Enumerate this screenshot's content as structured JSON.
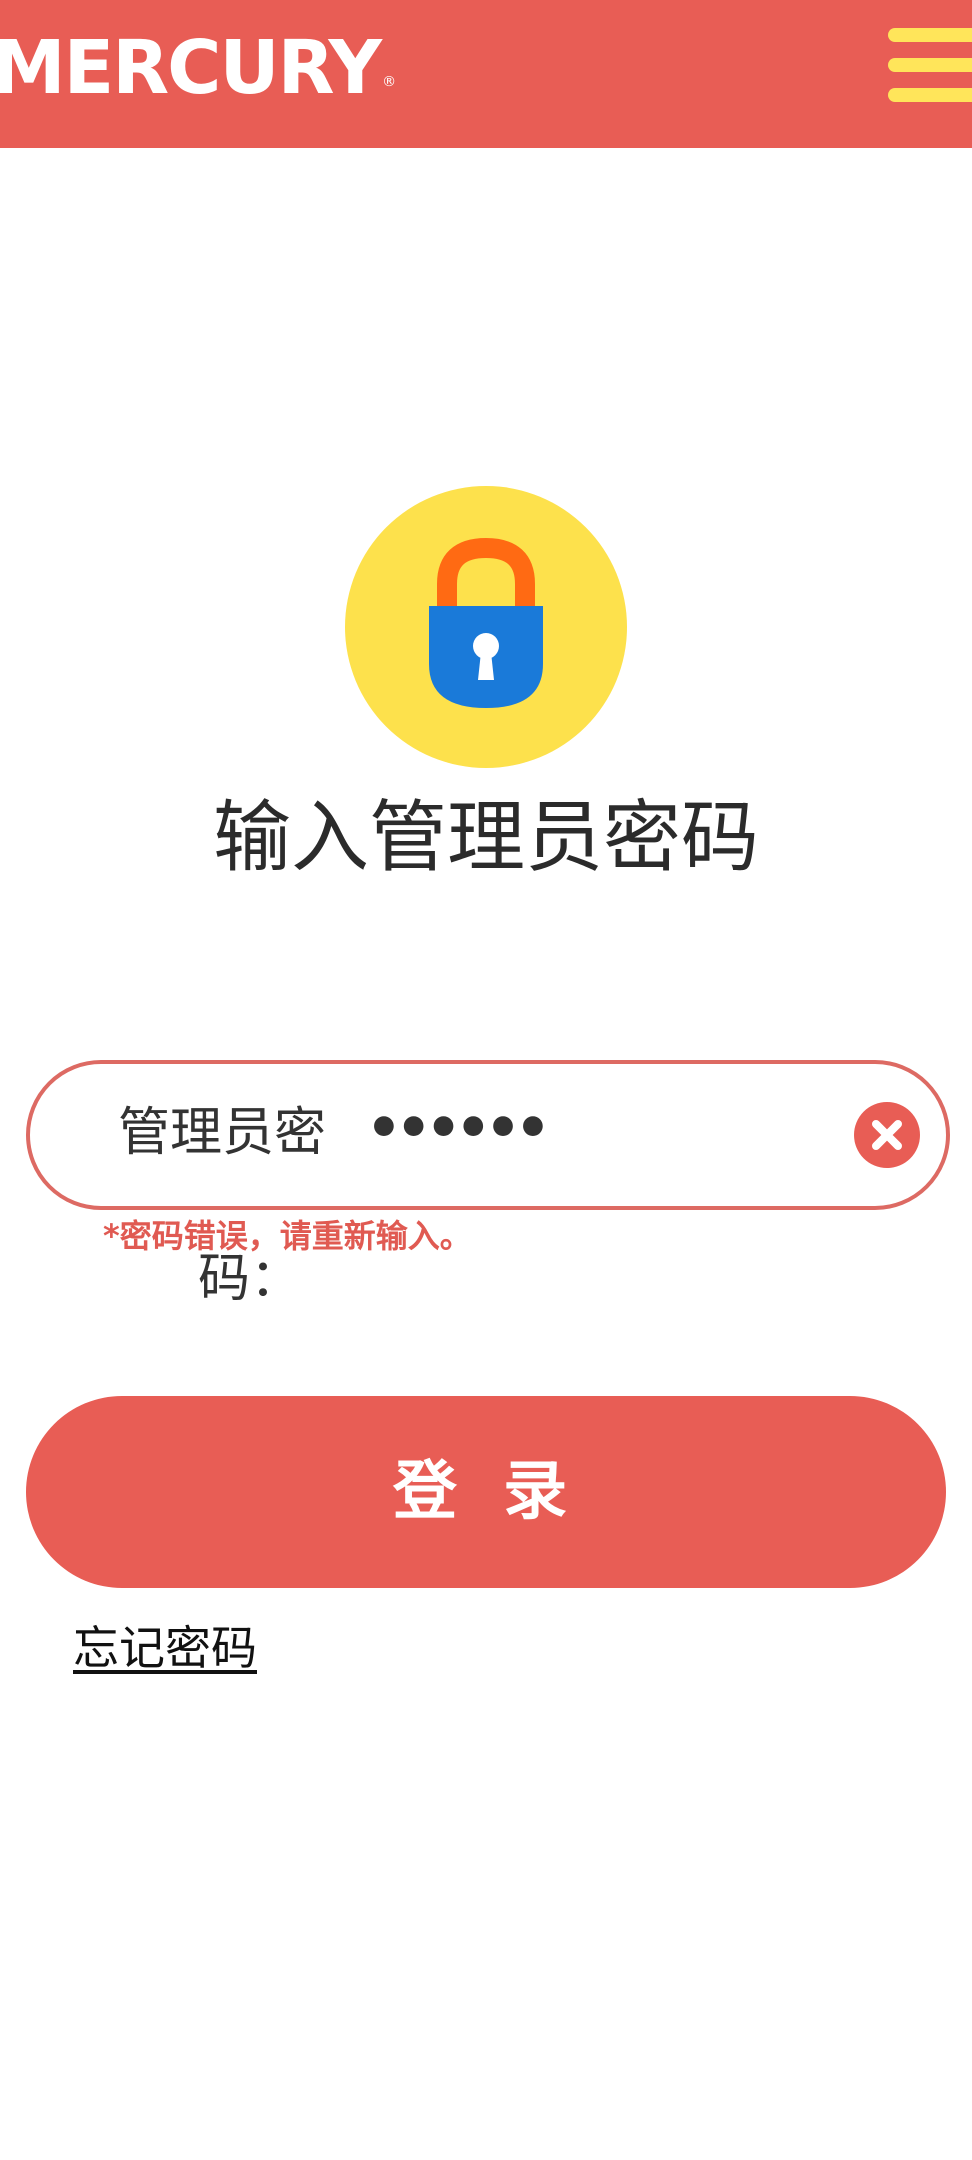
{
  "header": {
    "brand": "MERCURY",
    "registered_mark": "®",
    "menu_icon": "hamburger-menu-icon"
  },
  "colors": {
    "brand_red": "#e85d55",
    "menu_yellow": "#ffe55a",
    "lock_circle": "#fde14c",
    "lock_body": "#1a7ad9",
    "lock_shackle": "#ff6a13"
  },
  "login": {
    "lock_icon": "padlock-icon",
    "title": "输入管理员密码",
    "password_label_line1": "管理员密",
    "password_label_line2": "码：",
    "password_value": "••••••",
    "clear_icon": "clear-x-icon",
    "error": "*密码错误，请重新输入。",
    "submit_label": "登 录",
    "forgot_password": "忘记密码"
  }
}
